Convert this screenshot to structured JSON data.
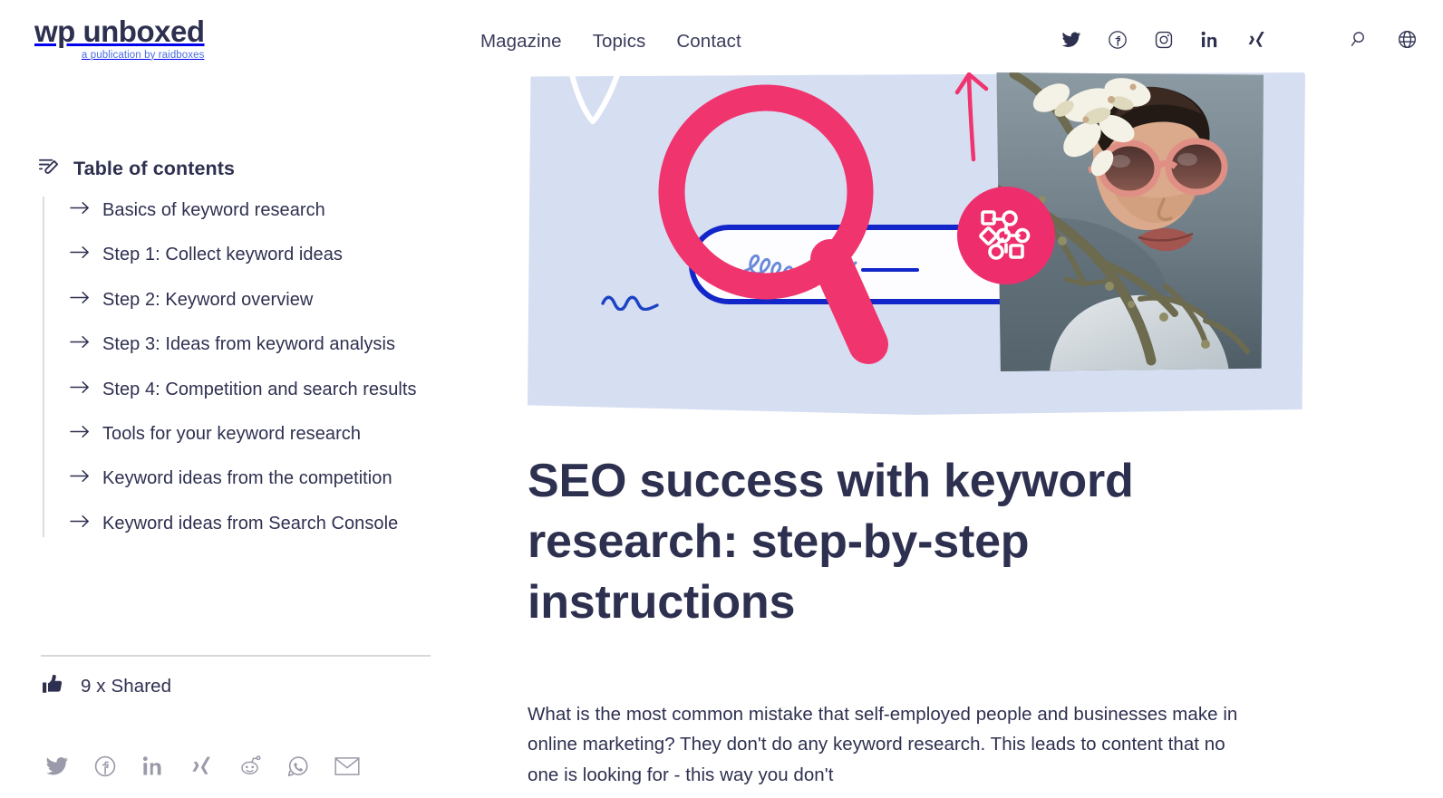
{
  "header": {
    "brand_name": "wp unboxed",
    "brand_tagline": "a publication by raidboxes",
    "nav": [
      {
        "label": "Magazine"
      },
      {
        "label": "Topics"
      },
      {
        "label": "Contact"
      }
    ],
    "social_icons": [
      {
        "name": "twitter-icon"
      },
      {
        "name": "facebook-icon"
      },
      {
        "name": "instagram-icon"
      },
      {
        "name": "linkedin-icon"
      },
      {
        "name": "xing-icon"
      }
    ],
    "utility_icons": [
      {
        "name": "search-icon"
      },
      {
        "name": "language-globe-icon"
      }
    ]
  },
  "sidebar": {
    "toc": {
      "icon": "table-of-contents-icon",
      "title": "Table of contents",
      "items": [
        {
          "label": "Basics of keyword research"
        },
        {
          "label": "Step 1: Collect keyword ideas"
        },
        {
          "label": "Step 2: Keyword overview"
        },
        {
          "label": "Step 3: Ideas from keyword analysis"
        },
        {
          "label": "Step 4: Competition and search results"
        },
        {
          "label": "Tools for your keyword research"
        },
        {
          "label": "Keyword ideas from the competition"
        },
        {
          "label": "Keyword ideas from Search Console"
        }
      ]
    },
    "share": {
      "count_icon": "thumbs-up-icon",
      "count_label": "9 x Shared",
      "buttons": [
        {
          "name": "share-twitter-icon"
        },
        {
          "name": "share-facebook-icon"
        },
        {
          "name": "share-linkedin-icon"
        },
        {
          "name": "share-xing-icon"
        },
        {
          "name": "share-reddit-icon"
        },
        {
          "name": "share-whatsapp-icon"
        },
        {
          "name": "share-email-icon"
        }
      ]
    }
  },
  "article": {
    "hero": {
      "alt": "Illustration: pink magnifying glass over a blue search bar next to a photo of a person with sunglasses behind blossom branches",
      "background_color": "#d6def2",
      "accent_pink": "#ee2e6c",
      "accent_blue": "#1226c9"
    },
    "headline": "SEO success with keyword research: step-by-step instructions",
    "lede": "What is the most common mistake that self-employed people and businesses make in online marketing? They don't do any keyword research. This leads to content that no one is looking for - this way you don't"
  },
  "colors": {
    "text": "#2e3050",
    "link_blue": "#4a6ee0",
    "pink": "#ee2e6c",
    "blue": "#1226c9",
    "muted": "#9a9aaa"
  }
}
